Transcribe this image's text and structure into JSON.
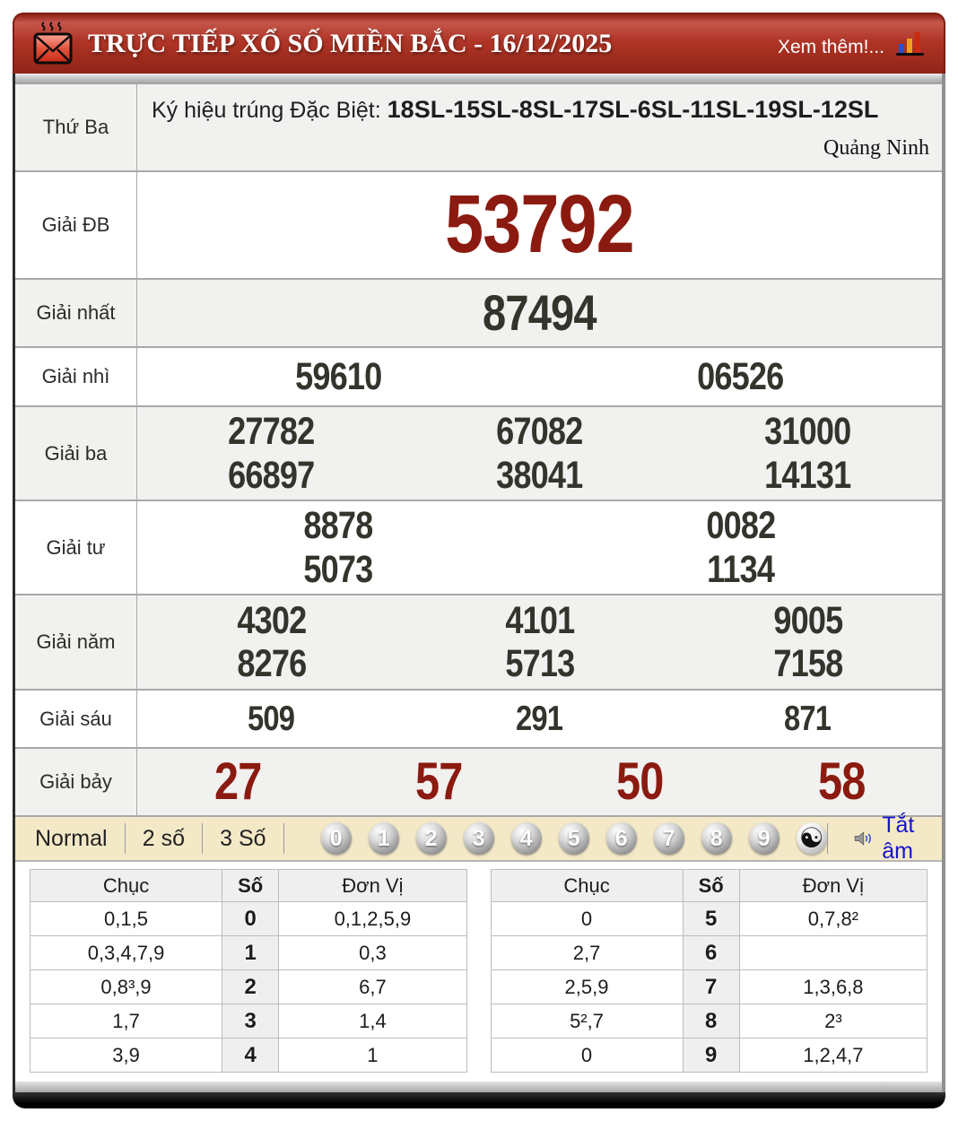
{
  "header": {
    "title": "TRỰC TIẾP XỔ SỐ MIỀN BẮC - 16/12/2025",
    "more_label": "Xem thêm!..."
  },
  "info_row": {
    "day_label": "Thứ Ba",
    "symbol_prefix": "Ký hiệu trúng Đặc Biệt:",
    "symbol_codes": "18SL-15SL-8SL-17SL-6SL-11SL-19SL-12SL",
    "province": "Quảng Ninh"
  },
  "prizes": [
    {
      "label": "Giải ĐB",
      "values": [
        "53792"
      ]
    },
    {
      "label": "Giải nhất",
      "values": [
        "87494"
      ]
    },
    {
      "label": "Giải nhì",
      "values": [
        "59610",
        "06526"
      ]
    },
    {
      "label": "Giải ba",
      "values": [
        "27782",
        "67082",
        "31000",
        "66897",
        "38041",
        "14131"
      ]
    },
    {
      "label": "Giải tư",
      "values": [
        "8878",
        "0082",
        "5073",
        "1134"
      ]
    },
    {
      "label": "Giải năm",
      "values": [
        "4302",
        "4101",
        "9005",
        "8276",
        "5713",
        "7158"
      ]
    },
    {
      "label": "Giải sáu",
      "values": [
        "509",
        "291",
        "871"
      ]
    },
    {
      "label": "Giải bảy",
      "values": [
        "27",
        "57",
        "50",
        "58"
      ]
    }
  ],
  "controls": {
    "modes": [
      "Normal",
      "2 số",
      "3 Số"
    ],
    "balls": [
      "0",
      "1",
      "2",
      "3",
      "4",
      "5",
      "6",
      "7",
      "8",
      "9"
    ],
    "yin_yang": "☯",
    "mute_label": "Tắt âm"
  },
  "summary": {
    "headers": {
      "chuc": "Chục",
      "so": "Số",
      "donvi": "Đơn Vị"
    },
    "left_rows": [
      [
        "0,1,5",
        "0",
        "0,1,2,5,9"
      ],
      [
        "0,3,4,7,9",
        "1",
        "0,3"
      ],
      [
        "0,8³,9",
        "2",
        "6,7"
      ],
      [
        "1,7",
        "3",
        "1,4"
      ],
      [
        "3,9",
        "4",
        "1"
      ]
    ],
    "right_rows": [
      [
        "0",
        "5",
        "0,7,8²"
      ],
      [
        "2,7",
        "6",
        ""
      ],
      [
        "2,5,9",
        "7",
        "1,3,6,8"
      ],
      [
        "5²,7",
        "8",
        "2³"
      ],
      [
        "0",
        "9",
        "1,2,4,7"
      ]
    ]
  },
  "colors": {
    "accent_red": "#8b1a10",
    "header_red": "#b03527",
    "number_dark": "#34332c",
    "control_beige": "#f3e9c7",
    "link_blue": "#1414cc"
  }
}
